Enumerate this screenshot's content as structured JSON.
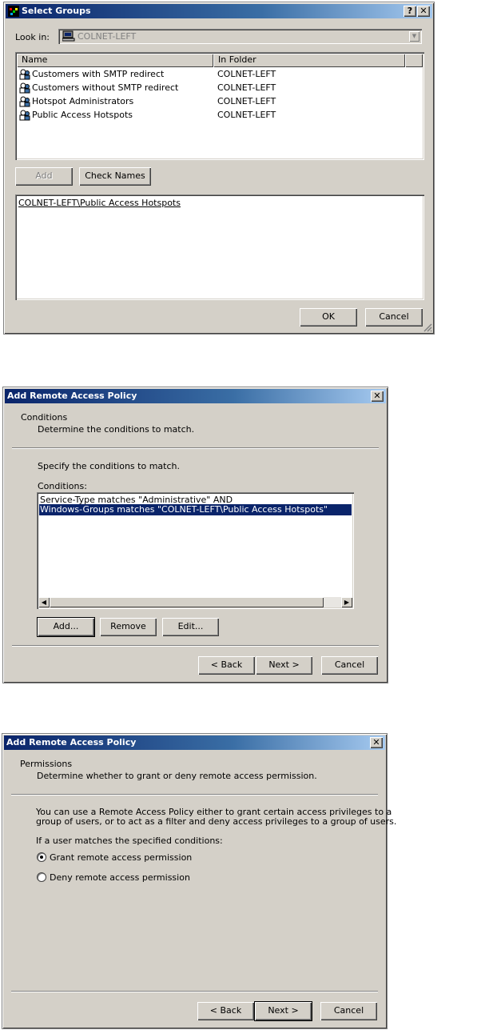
{
  "select_groups": {
    "title": "Select Groups",
    "help_btn": "?",
    "close_btn": "✕",
    "look_in_label": "Look in:",
    "look_in_value": "COLNET-LEFT",
    "col_name": "Name",
    "col_folder": "In Folder",
    "rows": [
      {
        "name": "Customers with SMTP redirect",
        "folder": "COLNET-LEFT"
      },
      {
        "name": "Customers without SMTP redirect",
        "folder": "COLNET-LEFT"
      },
      {
        "name": "Hotspot Administrators",
        "folder": "COLNET-LEFT"
      },
      {
        "name": "Public Access Hotspots",
        "folder": "COLNET-LEFT"
      }
    ],
    "add_btn": "Add",
    "check_names_btn": "Check Names",
    "selected_text": "COLNET-LEFT\\Public Access Hotspots",
    "ok_btn": "OK",
    "cancel_btn": "Cancel"
  },
  "conditions_dialog": {
    "title": "Add Remote Access Policy",
    "close_btn": "✕",
    "header_title": "Conditions",
    "header_sub": "Determine the conditions to match.",
    "intro": "Specify the conditions to match.",
    "list_label": "Conditions:",
    "items": [
      "Service-Type matches \"Administrative\" AND",
      "Windows-Groups matches \"COLNET-LEFT\\Public Access Hotspots\""
    ],
    "add_btn": "Add...",
    "remove_btn": "Remove",
    "edit_btn": "Edit...",
    "back_btn": "< Back",
    "next_btn": "Next >",
    "cancel_btn": "Cancel"
  },
  "permissions_dialog": {
    "title": "Add Remote Access Policy",
    "close_btn": "✕",
    "header_title": "Permissions",
    "header_sub": "Determine whether to grant or deny remote access permission.",
    "desc_line1": "You can use a Remote Access Policy either to grant certain access privileges to a",
    "desc_line2": "group of users, or to act as a filter and deny access privileges to a group of users.",
    "if_label": "If a user matches the specified conditions:",
    "grant_label": "Grant remote access permission",
    "deny_label": "Deny remote access permission",
    "back_btn": "< Back",
    "next_btn": "Next >",
    "cancel_btn": "Cancel"
  }
}
